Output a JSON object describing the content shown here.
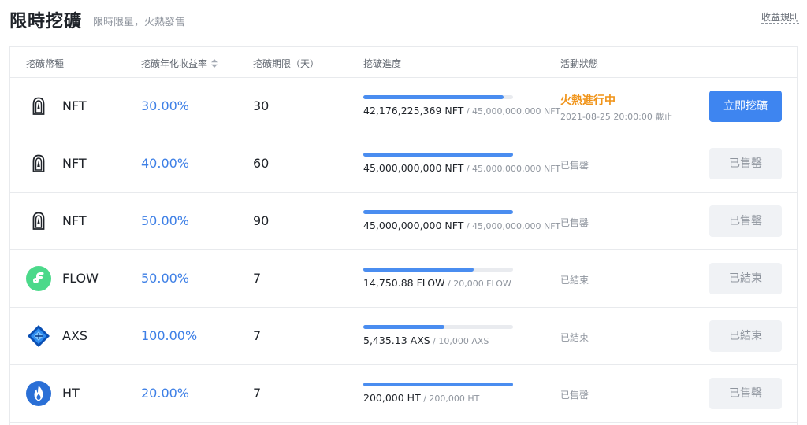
{
  "header": {
    "title": "限時挖礦",
    "subtitle": "限時限量，火熱發售",
    "rules_link": "收益規則"
  },
  "table": {
    "columns": [
      "挖礦幣種",
      "挖礦年化收益率",
      "挖礦期限（天）",
      "挖礦進度",
      "活動狀態"
    ],
    "rows": [
      {
        "coin": "NFT",
        "icon": "nft-icon",
        "rate": "30.00%",
        "period": "30",
        "progress_fraction": 0.937,
        "progress_current": "42,176,225,369 NFT",
        "progress_total": " / 45,000,000,000 NFT",
        "status": "火熱進行中",
        "deadline": "2021-08-25 20:00:00 截止",
        "action": "立即挖礦",
        "action_enabled": true
      },
      {
        "coin": "NFT",
        "icon": "nft-icon",
        "rate": "40.00%",
        "period": "60",
        "progress_fraction": 1.0,
        "progress_current": "45,000,000,000 NFT",
        "progress_total": " / 45,000,000,000 NFT",
        "status": "已售罄",
        "action": "已售罄",
        "action_enabled": false
      },
      {
        "coin": "NFT",
        "icon": "nft-icon",
        "rate": "50.00%",
        "period": "90",
        "progress_fraction": 1.0,
        "progress_current": "45,000,000,000 NFT",
        "progress_total": " / 45,000,000,000 NFT",
        "status": "已售罄",
        "action": "已售罄",
        "action_enabled": false
      },
      {
        "coin": "FLOW",
        "icon": "flow-icon",
        "rate": "50.00%",
        "period": "7",
        "progress_fraction": 0.7375,
        "progress_current": "14,750.88 FLOW",
        "progress_total": " / 20,000 FLOW",
        "status": "已結束",
        "action": "已結束",
        "action_enabled": false
      },
      {
        "coin": "AXS",
        "icon": "axs-icon",
        "rate": "100.00%",
        "period": "7",
        "progress_fraction": 0.5435,
        "progress_current": "5,435.13 AXS",
        "progress_total": " / 10,000 AXS",
        "status": "已結束",
        "action": "已結束",
        "action_enabled": false
      },
      {
        "coin": "HT",
        "icon": "ht-icon",
        "rate": "20.00%",
        "period": "7",
        "progress_fraction": 1.0,
        "progress_current": "200,000 HT",
        "progress_total": " / 200,000 HT",
        "status": "已售罄",
        "action": "已售罄",
        "action_enabled": false
      }
    ]
  },
  "colors": {
    "accent": "#3e85f0",
    "rate_text": "#3d7fe6",
    "hot_status": "#f0941a",
    "muted_text": "#8f959e"
  }
}
